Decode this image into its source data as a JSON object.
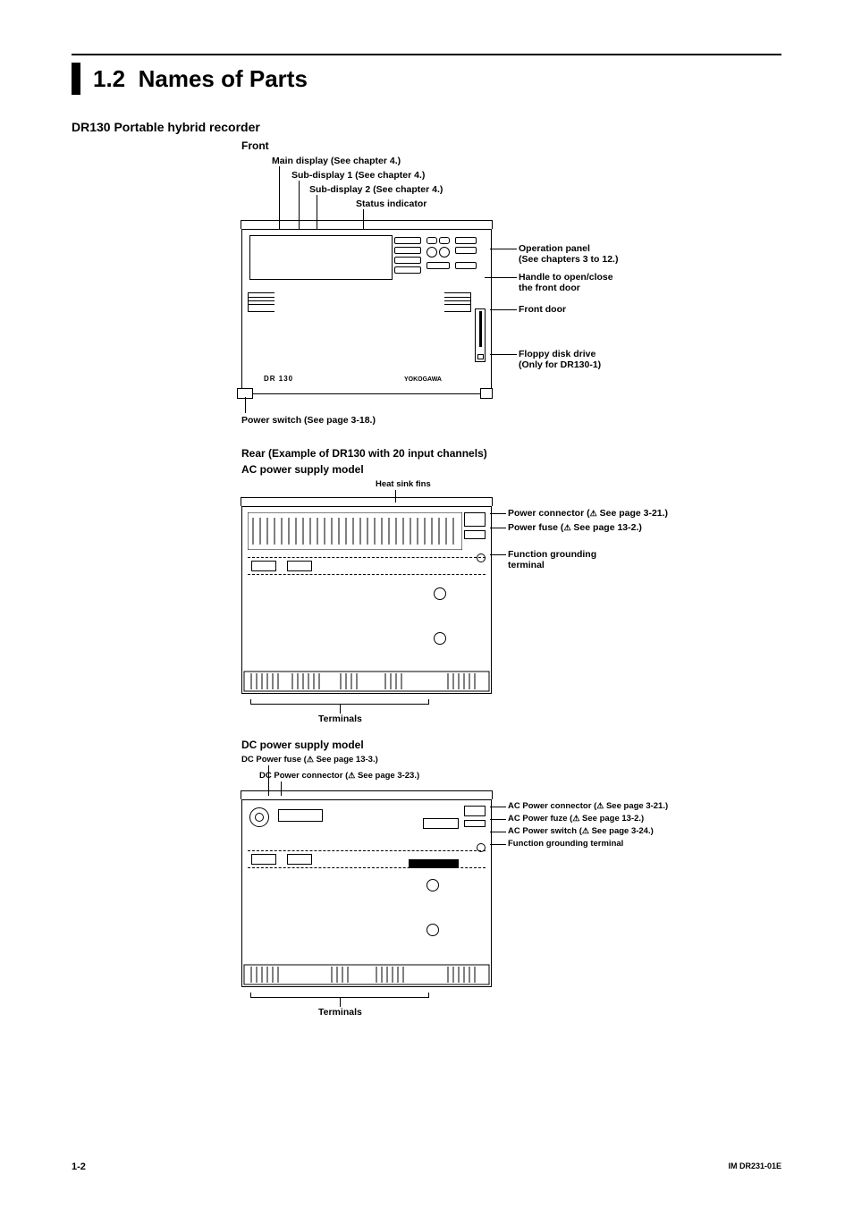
{
  "section_number": "1.2",
  "section_title": "Names of Parts",
  "device_heading": "DR130 Portable hybrid recorder",
  "doc_id": "IM DR231-01E",
  "page_number": "1-2",
  "front": {
    "heading": "Front",
    "top_labels": {
      "main_display": "Main display (See chapter 4.)",
      "sub_display_1": "Sub-display 1 (See chapter 4.)",
      "sub_display_2": "Sub-display 2 (See chapter 4.)",
      "status_indicator": "Status indicator"
    },
    "right_labels": {
      "operation_panel_1": "Operation panel",
      "operation_panel_2": "(See chapters 3 to 12.)",
      "handle_1": "Handle to open/close",
      "handle_2": "the front door",
      "front_door": "Front door",
      "floppy_1": "Floppy disk drive",
      "floppy_2": "(Only for DR130-1)"
    },
    "bottom_label": "Power switch (See page 3-18.)",
    "device_logo": "DR 130",
    "brand": "YOKOGAWA"
  },
  "rear": {
    "heading": "Rear (Example of DR130 with 20 input channels)",
    "ac": {
      "heading": "AC power supply model",
      "top_label": "Heat sink fins",
      "right": {
        "power_connector_pre": "Power connector (",
        "power_connector_post": " See page 3-21.)",
        "power_fuse_pre": "Power fuse (",
        "power_fuse_post": " See page 13-2.)",
        "function_grounding_1": "Function grounding",
        "function_grounding_2": "terminal"
      },
      "bottom_label": "Terminals"
    },
    "dc": {
      "heading": "DC power supply model",
      "top": {
        "dc_fuse_pre": "DC Power fuse (",
        "dc_fuse_post": " See page 13-3.)",
        "dc_conn_pre": "DC Power connector (",
        "dc_conn_post": " See page 3-23.)"
      },
      "right": {
        "ac_conn_pre": "AC Power connector (",
        "ac_conn_post": " See page 3-21.)",
        "ac_fuze_pre": "AC Power fuze (",
        "ac_fuze_post": " See page 13-2.)",
        "ac_switch_pre": "AC Power switch (",
        "ac_switch_post": " See page 3-24.)",
        "func_ground": "Function grounding terminal"
      },
      "bottom_label": "Terminals"
    }
  }
}
